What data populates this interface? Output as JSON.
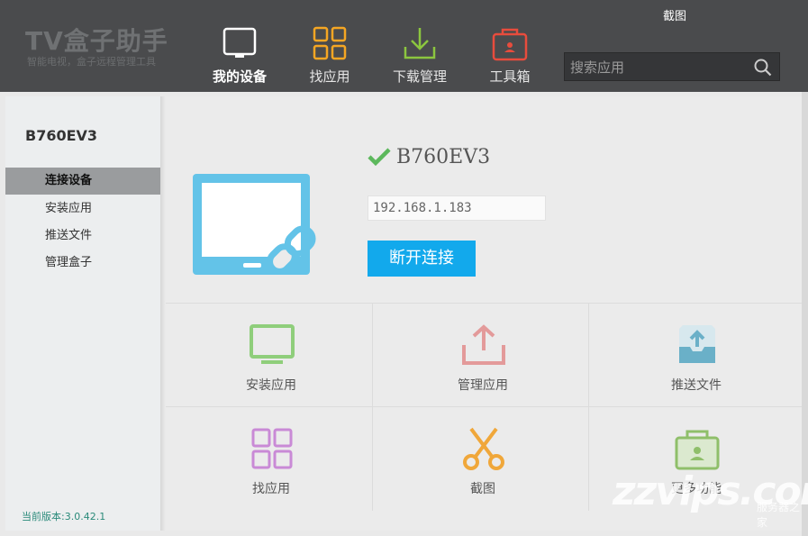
{
  "header": {
    "app_title": "TV盒子助手",
    "app_subtitle": "智能电视，盒子远程管理工具",
    "screenshot_link": "截图",
    "nav": [
      {
        "label": "我的设备",
        "icon": "tv-icon",
        "active": true,
        "color": "#ffffff"
      },
      {
        "label": "找应用",
        "icon": "grid-icon",
        "active": false,
        "color": "#f5a623"
      },
      {
        "label": "下载管理",
        "icon": "download-icon",
        "active": false,
        "color": "#8cc63f"
      },
      {
        "label": "工具箱",
        "icon": "toolbox-icon",
        "active": false,
        "color": "#e84c3d"
      }
    ],
    "search_placeholder": "搜索应用"
  },
  "sidebar": {
    "device_name": "B760EV3",
    "items": [
      {
        "label": "连接设备",
        "active": true
      },
      {
        "label": "安装应用",
        "active": false
      },
      {
        "label": "推送文件",
        "active": false
      },
      {
        "label": "管理盒子",
        "active": false
      }
    ],
    "version": "当前版本:3.0.42.1"
  },
  "device": {
    "name": "B760EV3",
    "ip": "192.168.1.183",
    "disconnect_label": "断开连接",
    "accent": "#12a9ec"
  },
  "tiles": [
    {
      "label": "安装应用",
      "icon": "monitor-icon",
      "color": "#8fce7b"
    },
    {
      "label": "管理应用",
      "icon": "upload-icon",
      "color": "#e39a9a"
    },
    {
      "label": "推送文件",
      "icon": "inbox-upload-icon",
      "color": "#6ab0c8"
    },
    {
      "label": "找应用",
      "icon": "grid-icon",
      "color": "#c98ad6"
    },
    {
      "label": "截图",
      "icon": "scissors-icon",
      "color": "#f0a73a"
    },
    {
      "label": "更多功能",
      "icon": "toolbox-icon",
      "color": "#8fbf6a"
    }
  ],
  "watermark": {
    "brand": "zzvips.com",
    "tag": "服务器之家"
  }
}
